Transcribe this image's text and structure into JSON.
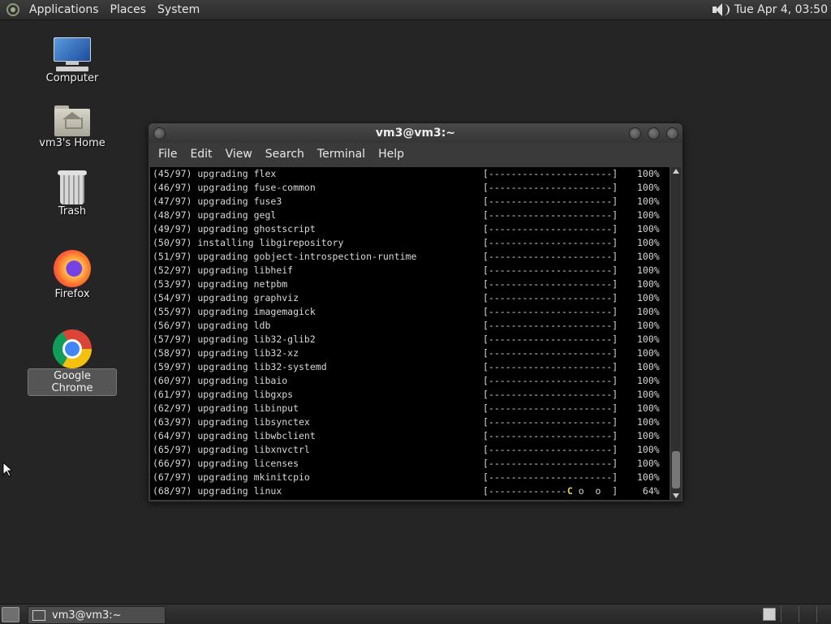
{
  "top_panel": {
    "menus": [
      "Applications",
      "Places",
      "System"
    ],
    "clock": "Tue Apr  4, 03:50"
  },
  "desktop_icons": [
    {
      "label": "Computer",
      "icon": "computer-icon"
    },
    {
      "label": "vm3's Home",
      "icon": "home-folder-icon"
    },
    {
      "label": "Trash",
      "icon": "trash-icon"
    },
    {
      "label": "Firefox",
      "icon": "firefox-icon"
    },
    {
      "label": "Google Chrome",
      "icon": "chrome-icon"
    }
  ],
  "window": {
    "title": "vm3@vm3:~",
    "menu": [
      "File",
      "Edit",
      "View",
      "Search",
      "Terminal",
      "Help"
    ]
  },
  "terminal": {
    "lines": [
      {
        "text": "(45/97) upgrading flex",
        "bar": "[----------------------]",
        "pct": "100%"
      },
      {
        "text": "(46/97) upgrading fuse-common",
        "bar": "[----------------------]",
        "pct": "100%"
      },
      {
        "text": "(47/97) upgrading fuse3",
        "bar": "[----------------------]",
        "pct": "100%"
      },
      {
        "text": "(48/97) upgrading gegl",
        "bar": "[----------------------]",
        "pct": "100%"
      },
      {
        "text": "(49/97) upgrading ghostscript",
        "bar": "[----------------------]",
        "pct": "100%"
      },
      {
        "text": "(50/97) installing libgirepository",
        "bar": "[----------------------]",
        "pct": "100%"
      },
      {
        "text": "(51/97) upgrading gobject-introspection-runtime",
        "bar": "[----------------------]",
        "pct": "100%"
      },
      {
        "text": "(52/97) upgrading libheif",
        "bar": "[----------------------]",
        "pct": "100%"
      },
      {
        "text": "(53/97) upgrading netpbm",
        "bar": "[----------------------]",
        "pct": "100%"
      },
      {
        "text": "(54/97) upgrading graphviz",
        "bar": "[----------------------]",
        "pct": "100%"
      },
      {
        "text": "(55/97) upgrading imagemagick",
        "bar": "[----------------------]",
        "pct": "100%"
      },
      {
        "text": "(56/97) upgrading ldb",
        "bar": "[----------------------]",
        "pct": "100%"
      },
      {
        "text": "(57/97) upgrading lib32-glib2",
        "bar": "[----------------------]",
        "pct": "100%"
      },
      {
        "text": "(58/97) upgrading lib32-xz",
        "bar": "[----------------------]",
        "pct": "100%"
      },
      {
        "text": "(59/97) upgrading lib32-systemd",
        "bar": "[----------------------]",
        "pct": "100%"
      },
      {
        "text": "(60/97) upgrading libaio",
        "bar": "[----------------------]",
        "pct": "100%"
      },
      {
        "text": "(61/97) upgrading libgxps",
        "bar": "[----------------------]",
        "pct": "100%"
      },
      {
        "text": "(62/97) upgrading libinput",
        "bar": "[----------------------]",
        "pct": "100%"
      },
      {
        "text": "(63/97) upgrading libsynctex",
        "bar": "[----------------------]",
        "pct": "100%"
      },
      {
        "text": "(64/97) upgrading libwbclient",
        "bar": "[----------------------]",
        "pct": "100%"
      },
      {
        "text": "(65/97) upgrading libxnvctrl",
        "bar": "[----------------------]",
        "pct": "100%"
      },
      {
        "text": "(66/97) upgrading licenses",
        "bar": "[----------------------]",
        "pct": "100%"
      },
      {
        "text": "(67/97) upgrading mkinitcpio",
        "bar": "[----------------------]",
        "pct": "100%"
      },
      {
        "text": "(68/97) upgrading linux",
        "bar_done": "[--------------",
        "bar_pac": "C",
        "bar_rest": " o  o  ]",
        "pct": " 64%"
      }
    ]
  },
  "taskbar": {
    "task_label": "vm3@vm3:~"
  }
}
